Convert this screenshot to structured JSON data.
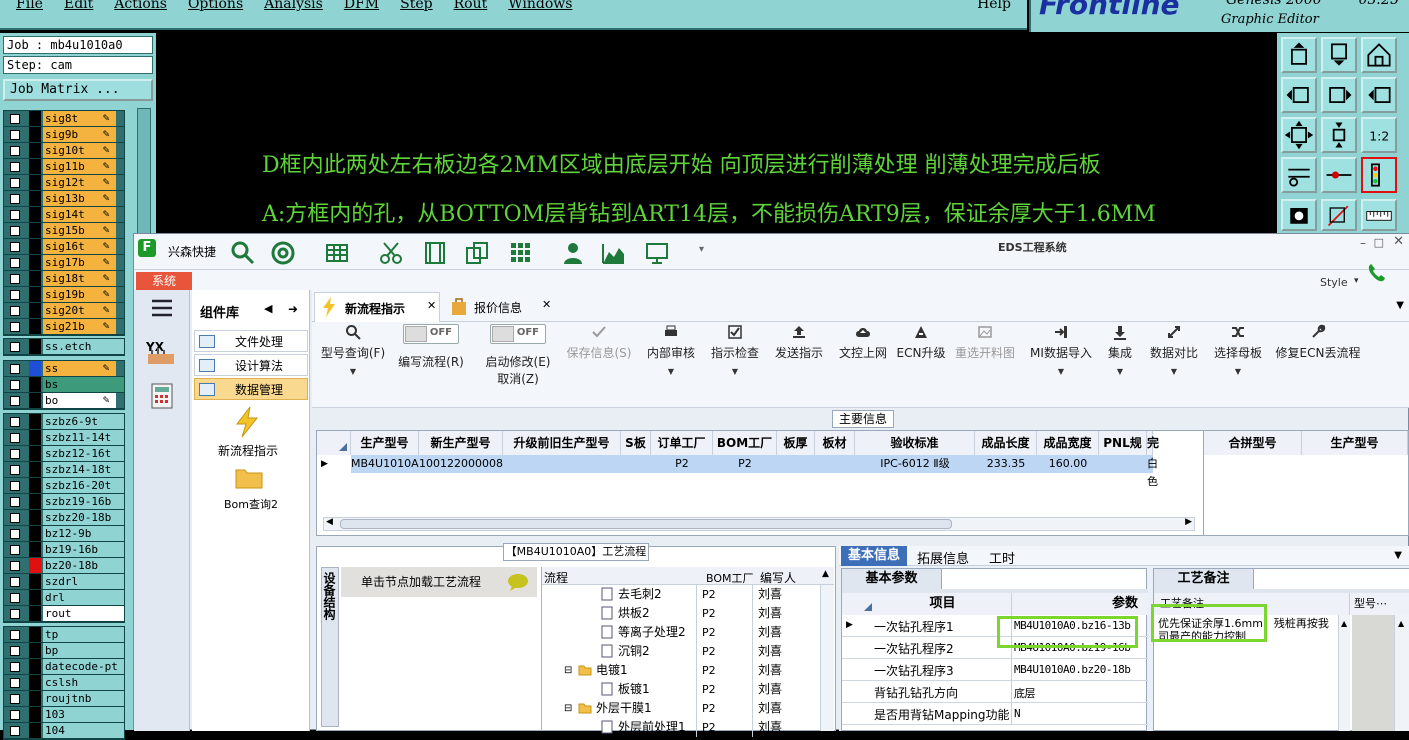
{
  "menubar": {
    "items": [
      "File",
      "Edit",
      "Actions",
      "Options",
      "Analysis",
      "DFM",
      "Step",
      "Rout",
      "Windows"
    ],
    "help": "Help"
  },
  "logo": {
    "brand": "Frontline",
    "product": "Genesis 2000",
    "subtitle": "Graphic Editor",
    "time": "03:25"
  },
  "job": {
    "job_label": "Job : mb4u1010a0",
    "step_label": "Step: cam",
    "matrix_button": "Job Matrix ..."
  },
  "layers_group1": [
    "sig8t",
    "sig9b",
    "sig10t",
    "sig11b",
    "sig12t",
    "sig13b",
    "sig14t",
    "sig15b",
    "sig16t",
    "sig17b",
    "sig18t",
    "sig19b",
    "sig20t",
    "sig21b"
  ],
  "layers_group2": [
    "ss.etch"
  ],
  "layers_group3": [
    "ss",
    "bs",
    "bo"
  ],
  "layers_group4": [
    "szbz6-9t",
    "szbz11-14t",
    "szbz12-16t",
    "szbz14-18t",
    "szbz16-20t",
    "szbz19-16b",
    "szbz20-18b",
    "bz12-9b",
    "bz19-16b",
    "bz20-18b",
    "szdrl",
    "drl",
    "rout"
  ],
  "layers_group5": [
    "tp",
    "bp",
    "datecode-pt",
    "cslsh",
    "roujtnb",
    "103",
    "104"
  ],
  "colors": {
    "orange": "#f4b23e",
    "teal": "#2f6f6f",
    "panel": "#8fd3d3",
    "green_text": "#5fd33a",
    "highlight": "#7cd630",
    "blue": "#1f4fd8",
    "red": "#e01010"
  },
  "canvas": {
    "line1": "D框内此两处左右板边各2MM区域由底层开始 向顶层进行削薄处理 削薄处理完成后板",
    "line2": "A:方框内的孔，从BOTTOM层背钻到ART14层，不能损伤ART9层，保证余厚大于1.6MM"
  },
  "eds": {
    "quick": "兴森快捷",
    "title": "EDS工程系统",
    "style": "Style",
    "system_tab": "系统",
    "complib_title": "组件库",
    "complib_items": [
      "文件处理",
      "设计算法",
      "数据管理"
    ],
    "complib_big": [
      "新流程指示",
      "Bom查询2"
    ],
    "tabs": [
      "新流程指示",
      "报价信息"
    ],
    "ribbon": {
      "query": "型号查询(F)",
      "toggle_off": "OFF",
      "write_flow": "编写流程(R)",
      "start_edit": "启动修改(E)",
      "cancel": "取消(Z)",
      "save": "保存信息(S)",
      "internal": "内部审核",
      "check": "指示检查",
      "send": "发送指示",
      "upload": "文控上网",
      "ecn": "ECN升级",
      "reselect": "重选开料图",
      "mi": "MI数据导入",
      "integrate": "集成",
      "compare": "数据对比",
      "mother": "选择母板",
      "fix": "修复ECN丢流程"
    },
    "main_info": "主要信息",
    "grid_headers": [
      "生产型号",
      "新生产型号",
      "升级前旧生产型号",
      "S板",
      "订单工厂",
      "BOM工厂",
      "板厚",
      "板材",
      "验收标准",
      "成品长度",
      "成品宽度",
      "PNL规格",
      "完"
    ],
    "grid_row": [
      "MB4U1010A0",
      "10012200000841",
      "",
      "",
      "P2",
      "P2",
      "",
      "",
      "IPC-6012 Ⅱ级",
      "233.35",
      "160.00",
      "",
      "白色"
    ],
    "merge_headers": [
      "合拼型号",
      "生产型号"
    ],
    "flow_title": "【MB4U1010A0】工艺流程",
    "flow_side": "设备结构",
    "flow_load": "单击节点加载工艺流程",
    "flow_headers": [
      "流程",
      "BOM工厂",
      "编写人"
    ],
    "flow_rows": [
      {
        "name": "去毛刺2",
        "bom": "P2",
        "who": "刘喜",
        "folder": false
      },
      {
        "name": "烘板2",
        "bom": "P2",
        "who": "刘喜",
        "folder": false
      },
      {
        "name": "等离子处理2",
        "bom": "P2",
        "who": "刘喜",
        "folder": false
      },
      {
        "name": "沉铜2",
        "bom": "P2",
        "who": "刘喜",
        "folder": false
      },
      {
        "name": "电镀1",
        "bom": "P2",
        "who": "刘喜",
        "folder": true
      },
      {
        "name": "板镀1",
        "bom": "P2",
        "who": "刘喜",
        "folder": false
      },
      {
        "name": "外层干膜1",
        "bom": "P2",
        "who": "刘喜",
        "folder": true
      },
      {
        "name": "外层前处理1",
        "bom": "P2",
        "who": "刘喜",
        "folder": false
      }
    ],
    "info_tabs": [
      "基本信息",
      "拓展信息",
      "工时"
    ],
    "basic_params": "基本参数",
    "param_headers": [
      "项目",
      "参数"
    ],
    "params": [
      {
        "k": "一次钻孔程序1",
        "v": "MB4U1010A0.bz16-13b"
      },
      {
        "k": "一次钻孔程序2",
        "v": "MB4U1010A0.bz19-16b"
      },
      {
        "k": "一次钻孔程序3",
        "v": "MB4U1010A0.bz20-18b"
      },
      {
        "k": "背钻孔钻孔方向",
        "v": "底层"
      },
      {
        "k": "是否用背钻Mapping功能",
        "v": "N"
      }
    ],
    "notes_tab": "工艺备注",
    "notes_header": "工艺备注",
    "notes_col2": "型号⋯",
    "notes_text": "优先保证余厚1.6mm，残桩再按我司最产的能力控制"
  }
}
